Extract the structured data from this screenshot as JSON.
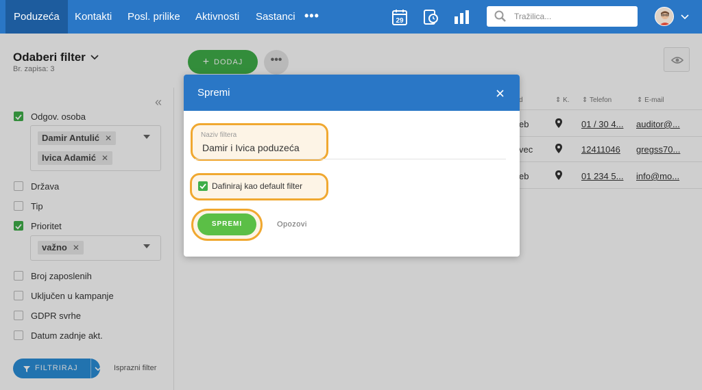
{
  "nav": {
    "tabs": [
      {
        "label": "Poduzeća",
        "active": true
      },
      {
        "label": "Kontakti"
      },
      {
        "label": "Posl. prilike"
      },
      {
        "label": "Aktivnosti"
      },
      {
        "label": "Sastanci"
      }
    ],
    "more_label": "•••",
    "calendar_day": "29",
    "icons": [
      "calendar-icon",
      "phone-book-icon",
      "bar-chart-icon",
      "search-icon",
      "avatar",
      "chevron-down-icon"
    ],
    "search_placeholder": "Tražilica..."
  },
  "page": {
    "filter_title": "Odaberi filter",
    "record_count": "Br. zapisa: 3",
    "add_button": "DODAJ",
    "more_button": "•••"
  },
  "sidebar": {
    "collapse_glyph": "«",
    "filters": [
      {
        "label": "Odgov. osoba",
        "checked": true,
        "tags": [
          "Damir Antulić",
          "Ivica Adamić"
        ]
      },
      {
        "label": "Država",
        "checked": false
      },
      {
        "label": "Tip",
        "checked": false
      },
      {
        "label": "Prioritet",
        "checked": true,
        "tags": [
          "važno"
        ]
      },
      {
        "label": "Broj zaposlenih",
        "checked": false
      },
      {
        "label": "Uključen u kampanje",
        "checked": false
      },
      {
        "label": "GDPR svrhe",
        "checked": false
      },
      {
        "label": "Datum zadnje akt.",
        "checked": false
      }
    ],
    "filter_button": "FILTRIRAJ",
    "clear_filter": "Isprazni filter",
    "tag_remove": "✕"
  },
  "table": {
    "columns": [
      "d",
      "K.",
      "Telefon",
      "E-mail"
    ],
    "rows": [
      {
        "city": "eb",
        "phone": "01 / 30 4...",
        "email": "auditor@..."
      },
      {
        "city": "vec",
        "phone": "12411046",
        "email": "gregss70..."
      },
      {
        "city": "eb",
        "phone": "01 234 5...",
        "email": "info@mo..."
      }
    ]
  },
  "modal": {
    "title": "Spremi",
    "field_label": "Naziv filtera",
    "field_value": "Damir i Ivica poduzeća",
    "default_label": "Dafiniraj kao default filter",
    "default_checked": true,
    "save_button": "SPREMI",
    "cancel_link": "Opozovi"
  },
  "colors": {
    "nav_blue": "#2a77c6",
    "nav_active": "#1d5c9e",
    "green": "#3fae49",
    "save_green": "#5bbf46",
    "highlight": "#f0a830"
  }
}
